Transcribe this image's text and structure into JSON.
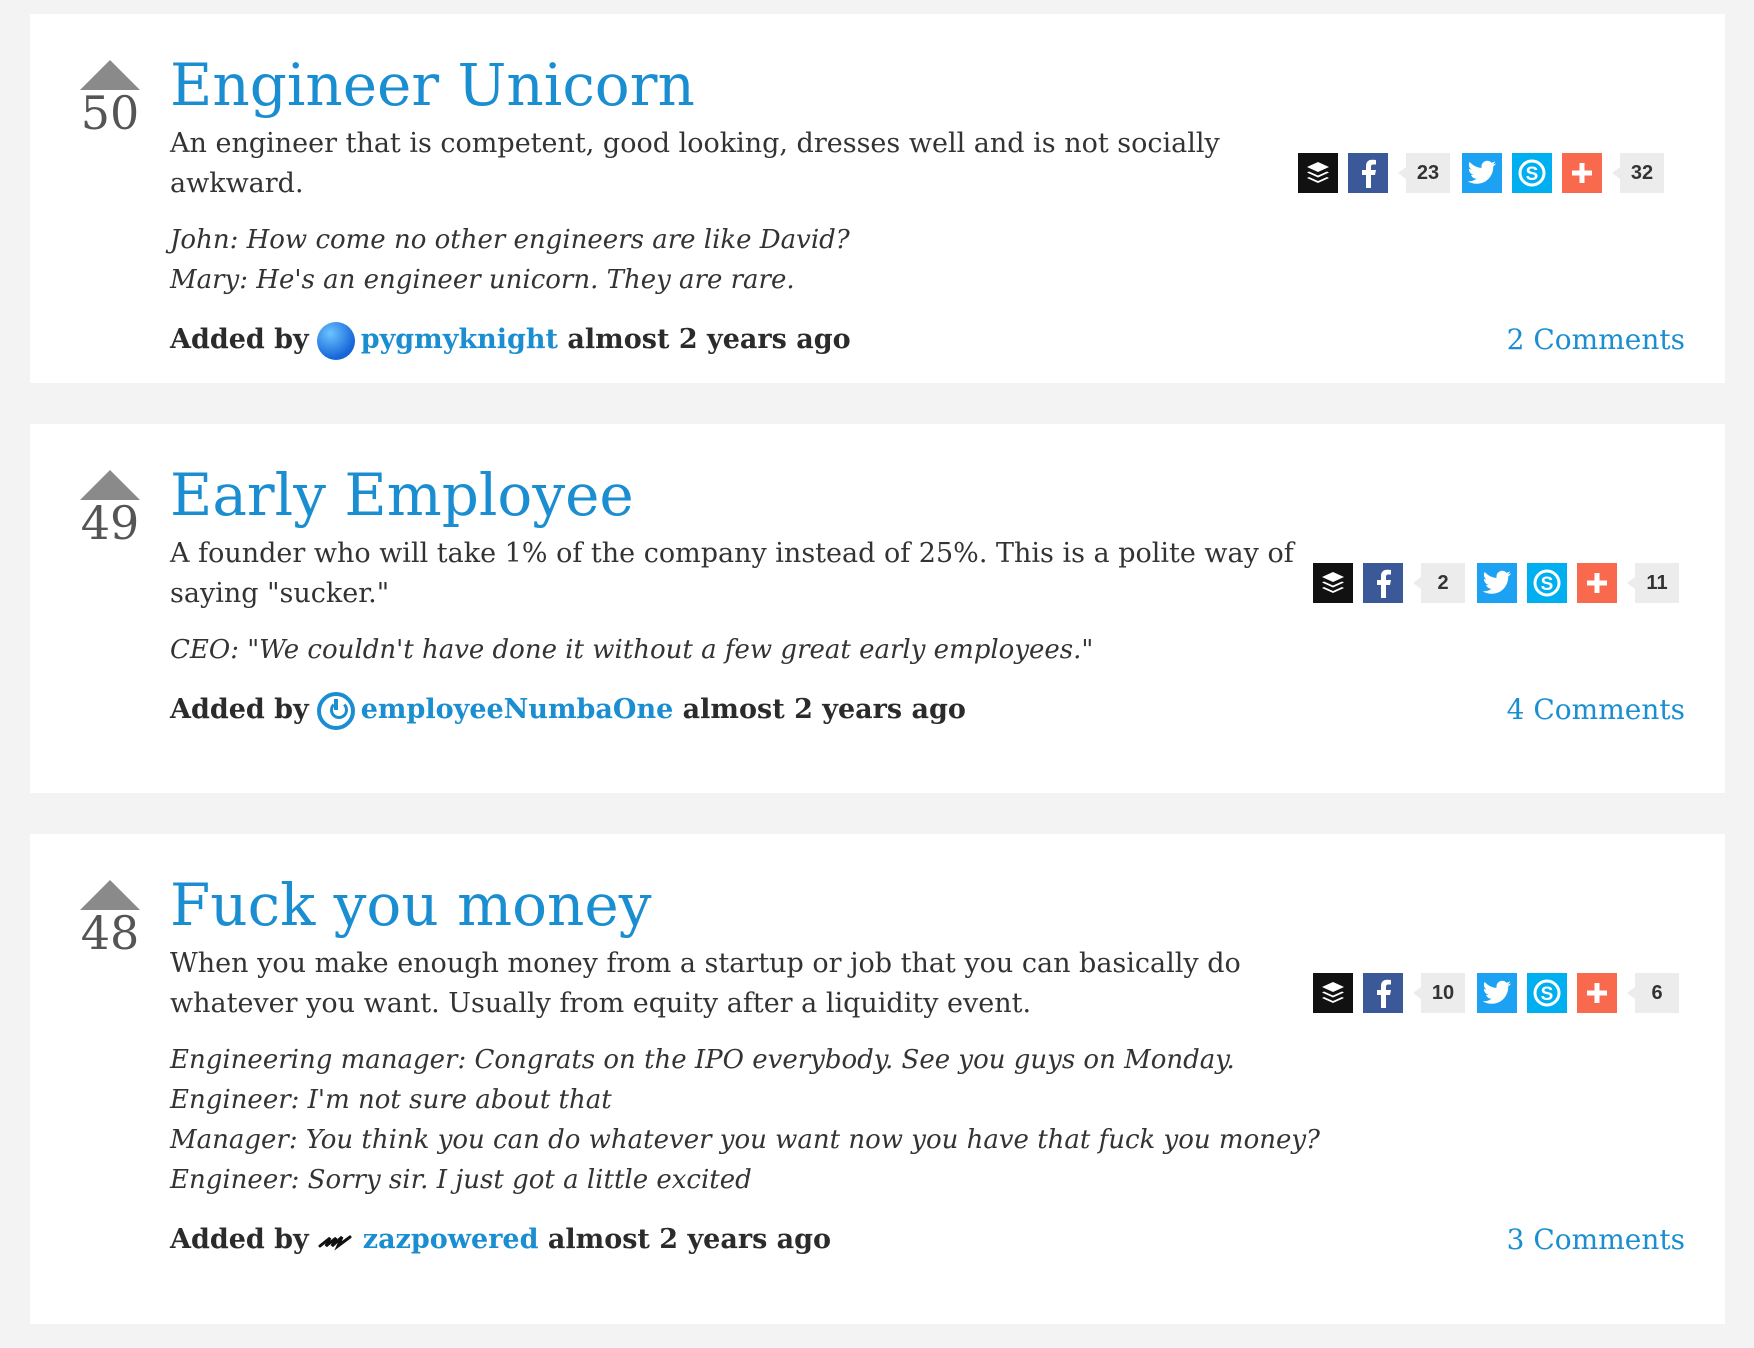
{
  "entries": [
    {
      "votes": "50",
      "title": "Engineer Unicorn",
      "definition": "An engineer that is competent, good looking, dresses well and is not socially awkward.",
      "example": [
        "John: How come no other engineers are like David?",
        "Mary: He's an engineer unicorn. They are rare."
      ],
      "added_by": "Added by",
      "author": "pygmyknight",
      "time": "almost 2 years ago",
      "comments": "2 Comments",
      "fb_count": "23",
      "share_count": "32"
    },
    {
      "votes": "49",
      "title": "Early Employee",
      "definition": "A founder who will take 1% of the company instead of 25%. This is a polite way of saying \"sucker.\"",
      "example": [
        "CEO: \"We couldn't have done it without a few great early employees.\""
      ],
      "added_by": "Added by",
      "author": "employeeNumbaOne",
      "time": "almost 2 years ago",
      "comments": "4 Comments",
      "fb_count": "2",
      "share_count": "11"
    },
    {
      "votes": "48",
      "title": "Fuck you money",
      "definition": "When you make enough money from a startup or job that you can basically do whatever you want. Usually from equity after a liquidity event.",
      "example": [
        "Engineering manager: Congrats on the IPO everybody. See you guys on Monday.",
        "Engineer: I'm not sure about that",
        "Manager: You think you can do whatever you want now you have that fuck you money?",
        "Engineer: Sorry sir. I just got a little excited"
      ],
      "added_by": "Added by",
      "author": "zazpowered",
      "time": "almost 2 years ago",
      "comments": "3 Comments",
      "fb_count": "10",
      "share_count": "6"
    }
  ],
  "colors": {
    "accent": "#1a8ed0",
    "background": "#f4f3f3",
    "vote_arrow": "#8a8a8a",
    "facebook": "#3b5998",
    "twitter": "#1da1f2",
    "skype": "#00aff0",
    "addthis": "#f8694d",
    "buffer": "#111111"
  },
  "icons": [
    "upvote-arrow-icon",
    "buffer-icon",
    "facebook-icon",
    "twitter-icon",
    "skype-icon",
    "plus-icon",
    "avatar"
  ]
}
